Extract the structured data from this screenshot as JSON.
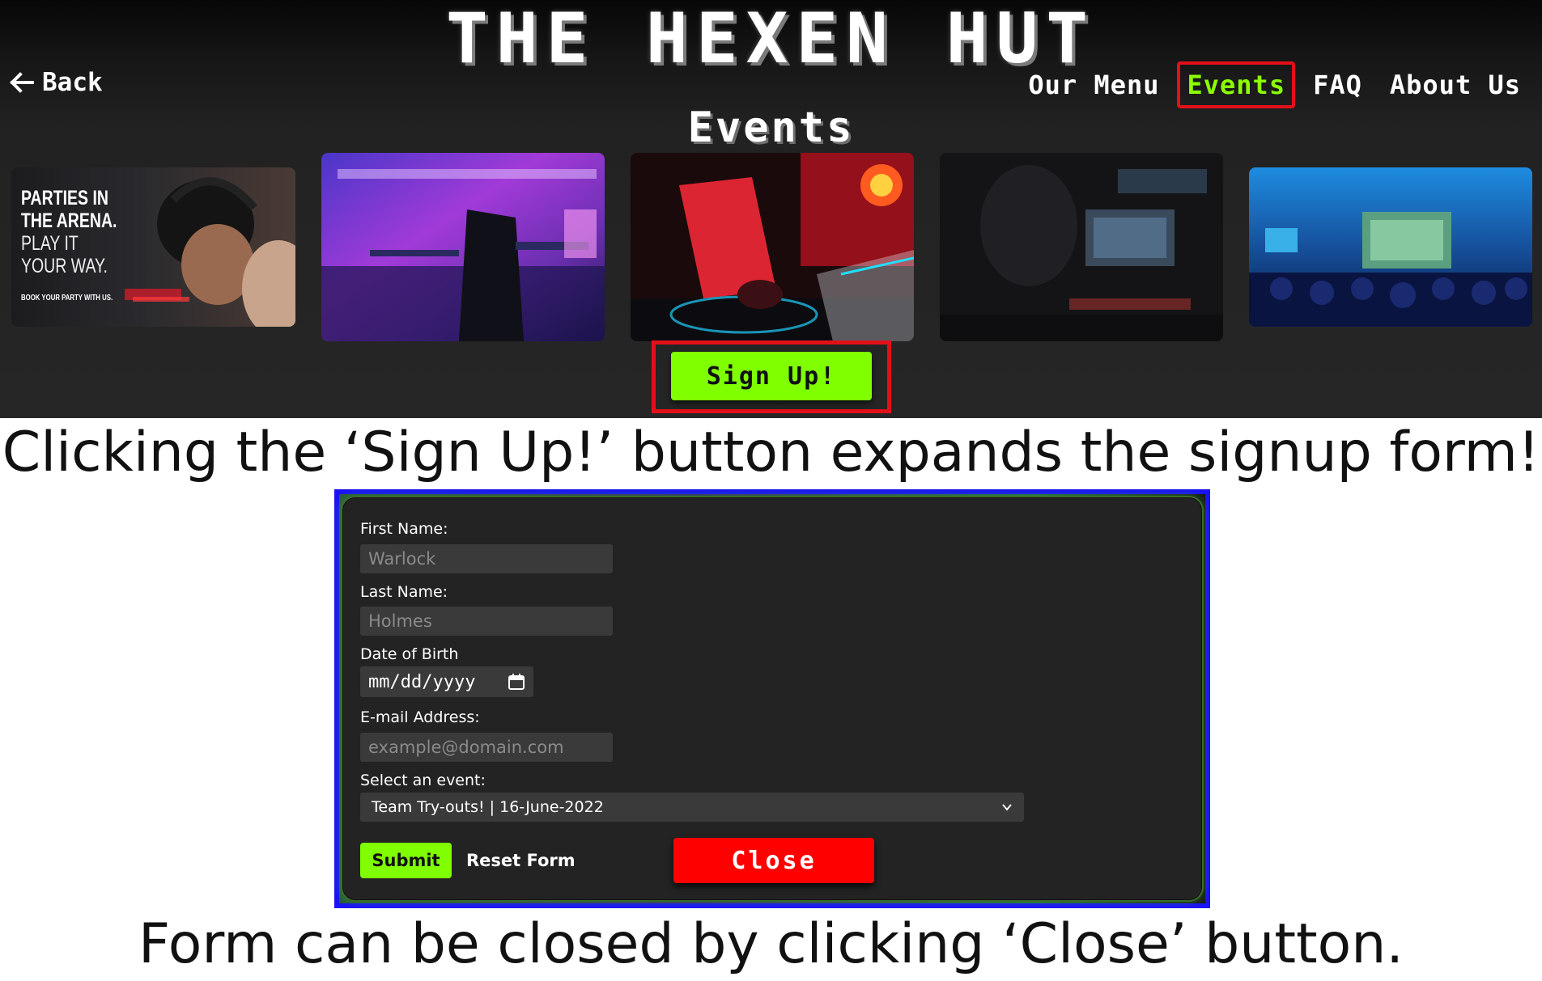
{
  "site": {
    "title": "THE HEXEN HUT",
    "back_label": "Back",
    "nav": [
      {
        "label": "Our Menu",
        "active": false
      },
      {
        "label": "Events",
        "active": true
      },
      {
        "label": "FAQ",
        "active": false
      },
      {
        "label": "About Us",
        "active": false
      }
    ],
    "events_heading": "Events",
    "gallery": [
      {
        "name": "parties-in-the-arena-promo",
        "text": {
          "line1": "PARTIES IN",
          "line2": "THE ARENA.",
          "line3": "PLAY IT",
          "line4": "YOUR WAY.",
          "small": "BOOK YOUR PARTY WITH US."
        }
      },
      {
        "name": "neon-gaming-room-photo"
      },
      {
        "name": "rgb-keyboard-setup-photo"
      },
      {
        "name": "gamer-at-monitors-photo"
      },
      {
        "name": "esports-audience-photo"
      }
    ],
    "signup_label": "Sign Up!"
  },
  "captions": {
    "first": "Clicking the ‘Sign Up!’ button expands the signup form!",
    "second": "Form can be closed by clicking ‘Close’ button."
  },
  "form": {
    "first_name_label": "First Name:",
    "first_name_placeholder": "Warlock",
    "last_name_label": "Last Name:",
    "last_name_placeholder": "Holmes",
    "dob_label": "Date of Birth",
    "dob_placeholder": "mm/dd/yyyy",
    "email_label": "E-mail Address:",
    "email_placeholder": "example@domain.com",
    "event_label": "Select an event:",
    "event_selected": "Team Try-outs! | 16-June-2022",
    "submit_label": "Submit",
    "reset_label": "Reset Form",
    "close_label": "Close"
  },
  "colors": {
    "accent_green": "#7fff00",
    "highlight_red": "#e3101a",
    "frame_blue": "#1b12f5",
    "close_red": "#ff0000"
  },
  "icons": {
    "back": "arrow-left-icon",
    "calendar": "calendar-icon",
    "select": "chevron-down-icon"
  }
}
